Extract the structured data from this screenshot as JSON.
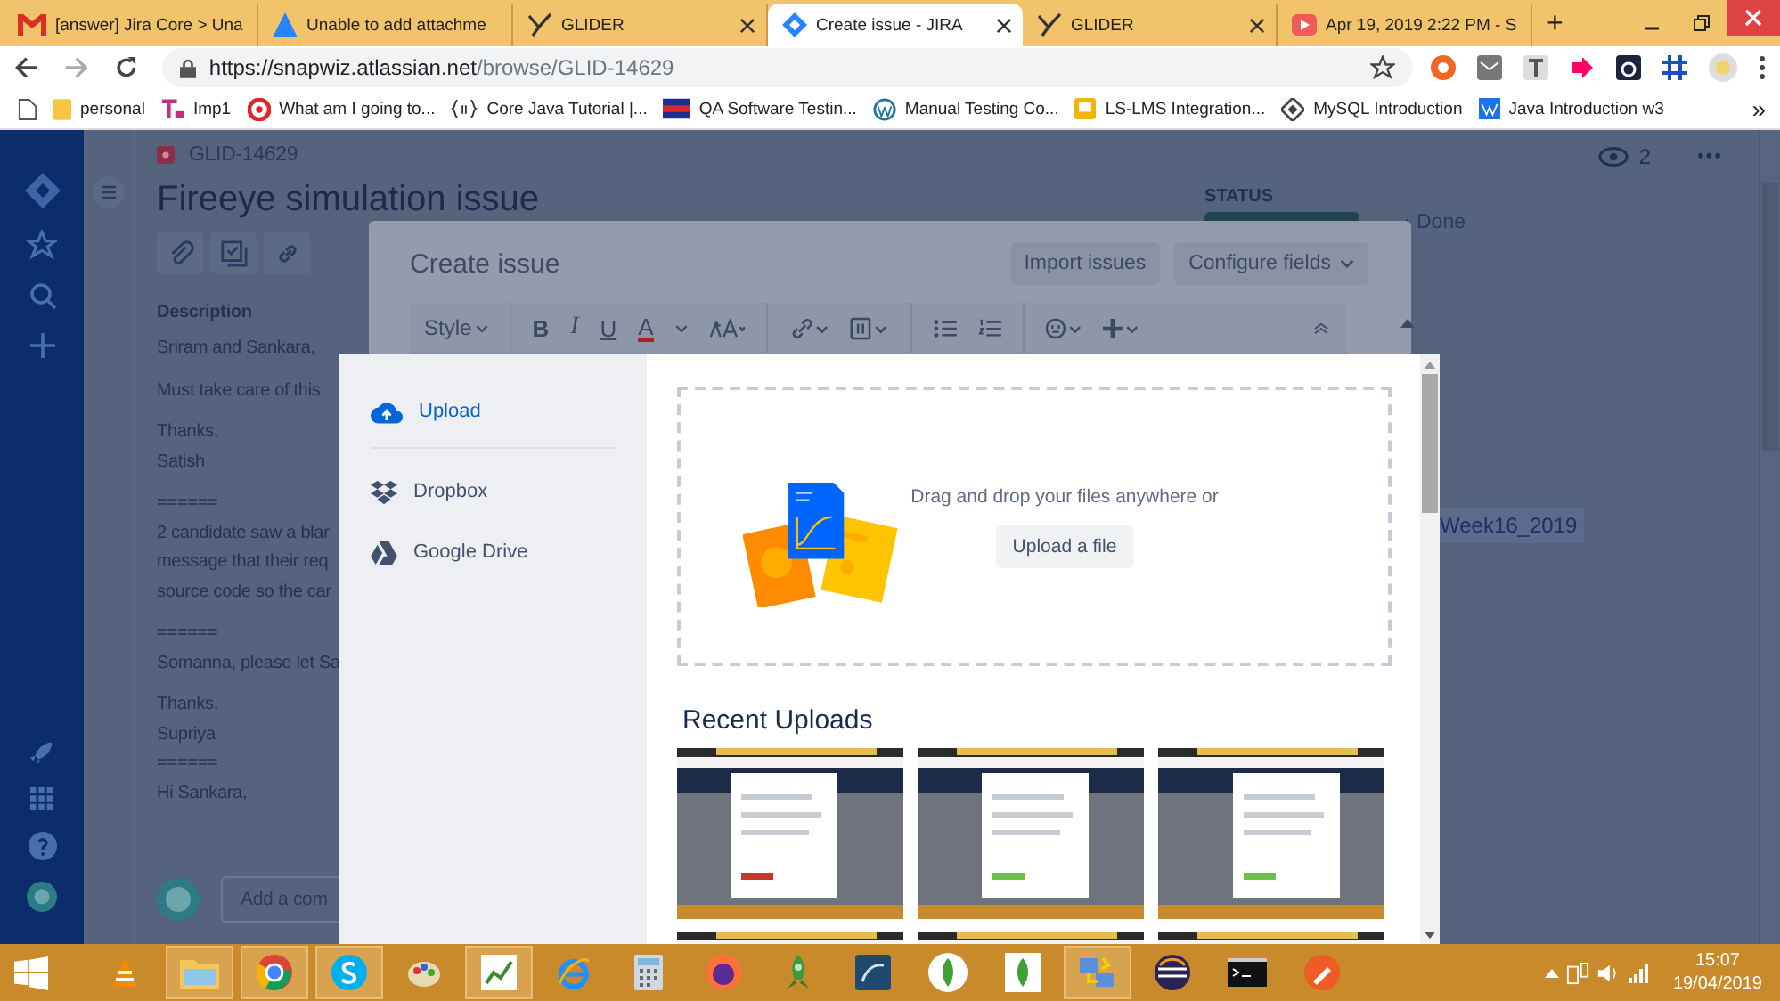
{
  "browser": {
    "tabs": [
      {
        "title": "[answer] Jira Core > Una",
        "kind": "mail",
        "selected": false,
        "close_button": false
      },
      {
        "title": "Unable to add attachme",
        "kind": "triangle",
        "selected": false,
        "close_button": false
      },
      {
        "title": "GLIDER",
        "kind": "swoosh",
        "selected": false,
        "close_button": true
      },
      {
        "title": "Create issue - JIRA",
        "kind": "diamond",
        "selected": true,
        "close_button": true
      },
      {
        "title": "GLIDER",
        "kind": "swoosh",
        "selected": false,
        "close_button": true
      },
      {
        "title": "Apr 19, 2019 2:22 PM - S",
        "kind": "play",
        "selected": false,
        "close_button": false
      }
    ],
    "new_tab": "+",
    "address": {
      "host": "https://snapwiz.atlassian.net",
      "path": "/browse/GLID-14629"
    },
    "bookmarks": [
      {
        "label": "personal",
        "kind": "folder"
      },
      {
        "label": "Imp1",
        "kind": "badge"
      },
      {
        "label": "What am I going to...",
        "kind": "target"
      },
      {
        "label": "Core Java Tutorial |...",
        "kind": "braces"
      },
      {
        "label": "QA Software Testin...",
        "kind": "flag"
      },
      {
        "label": "Manual Testing Co...",
        "kind": "globe"
      },
      {
        "label": "LS-LMS Integration...",
        "kind": "square"
      },
      {
        "label": "MySQL Introduction",
        "kind": "diamond"
      },
      {
        "label": "Java Introduction w3",
        "kind": "tile"
      }
    ],
    "bookmarks_more": "»"
  },
  "jira": {
    "issue_key": "GLID-14629",
    "title": "Fireeye simulation issue",
    "description_heading": "Description",
    "description": [
      [
        "Sriram and Sankara,"
      ],
      [
        "Must take care of this"
      ],
      [
        "Thanks,",
        "Satish"
      ],
      [
        "======",
        "2 candidate saw a blar",
        "message that their req",
        "source code so the car"
      ],
      [
        "======",
        "Somanna, please let Sa"
      ],
      [
        "Thanks,",
        "Supriya",
        "======",
        "Hi Sankara,"
      ]
    ],
    "comment_placeholder": "Add a com",
    "watchers": "2",
    "more": "•••",
    "status_label": "STATUS",
    "resolution": "Done",
    "sprint": "Week16_2019"
  },
  "create_issue": {
    "title": "Create issue",
    "buttons": [
      "Import issues",
      "Configure fields"
    ],
    "toolbar": {
      "style": "Style",
      "bold": "B",
      "italic": "I",
      "underline": "U",
      "font_letter": "A"
    }
  },
  "upload_dialog": {
    "sources": [
      {
        "label": "Upload",
        "kind": "upload",
        "selected": true
      },
      {
        "label": "Dropbox",
        "kind": "dropbox",
        "selected": false
      },
      {
        "label": "Google Drive",
        "kind": "drive",
        "selected": false
      }
    ],
    "drop_text": "Drag and drop your files anywhere or",
    "upload_button": "Upload a file",
    "recent_heading": "Recent Uploads"
  },
  "taskbar": {
    "apps": [
      {
        "running": false
      },
      {
        "running": true
      },
      {
        "running": true
      },
      {
        "running": true
      },
      {
        "running": false
      },
      {
        "running": true
      },
      {
        "running": false
      },
      {
        "running": false
      },
      {
        "running": false
      },
      {
        "running": false
      },
      {
        "running": false
      },
      {
        "running": false
      },
      {
        "running": false
      },
      {
        "running": true
      },
      {
        "running": false
      },
      {
        "running": false
      },
      {
        "running": false
      }
    ],
    "clock": {
      "time": "15:07",
      "date": "19/04/2019"
    }
  }
}
